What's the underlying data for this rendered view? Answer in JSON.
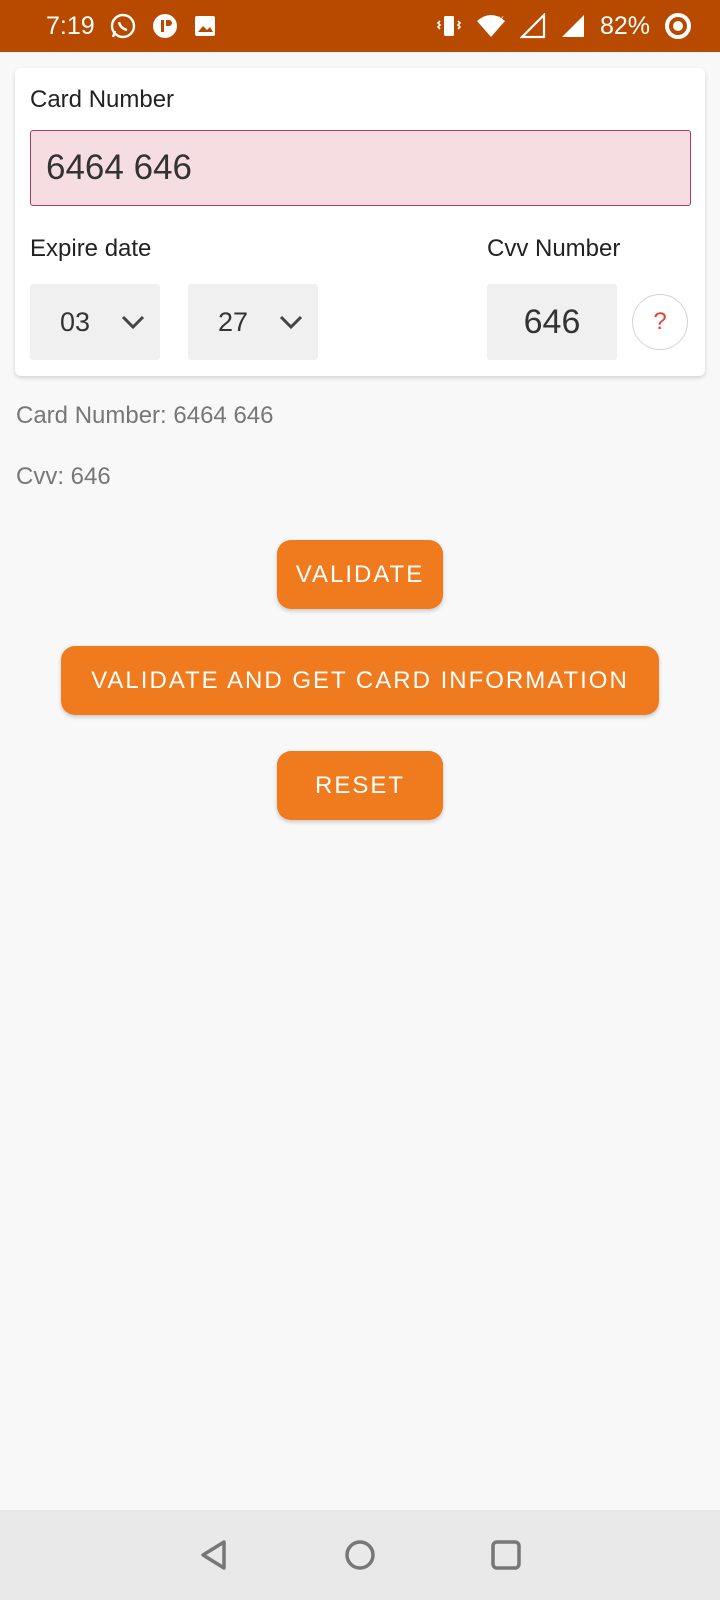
{
  "status_bar": {
    "time": "7:19",
    "battery_percent": "82%",
    "icons_left": [
      "whatsapp-icon",
      "app-icon",
      "gallery-icon"
    ],
    "icons_right": [
      "vibrate-icon",
      "wifi-icon",
      "signal-icon",
      "signal-icon",
      "battery-icon"
    ]
  },
  "form": {
    "card_number_label": "Card Number",
    "card_number_value": "6464 646",
    "expire_label": "Expire date",
    "expire_month": "03",
    "expire_year": "27",
    "cvv_label": "Cvv Number",
    "cvv_value": "646",
    "help_symbol": "?"
  },
  "info": {
    "card_number_line": "Card Number: 6464 646",
    "cvv_line": "Cvv: 646"
  },
  "buttons": {
    "validate": "VALIDATE",
    "validate_info": "VALIDATE AND GET CARD INFORMATION",
    "reset": "RESET"
  },
  "colors": {
    "status_bar": "#b84a00",
    "accent": "#f07a1e",
    "error_field_bg": "#f6dde2",
    "error_field_border": "#b23a60",
    "help_icon": "#e0453b"
  }
}
